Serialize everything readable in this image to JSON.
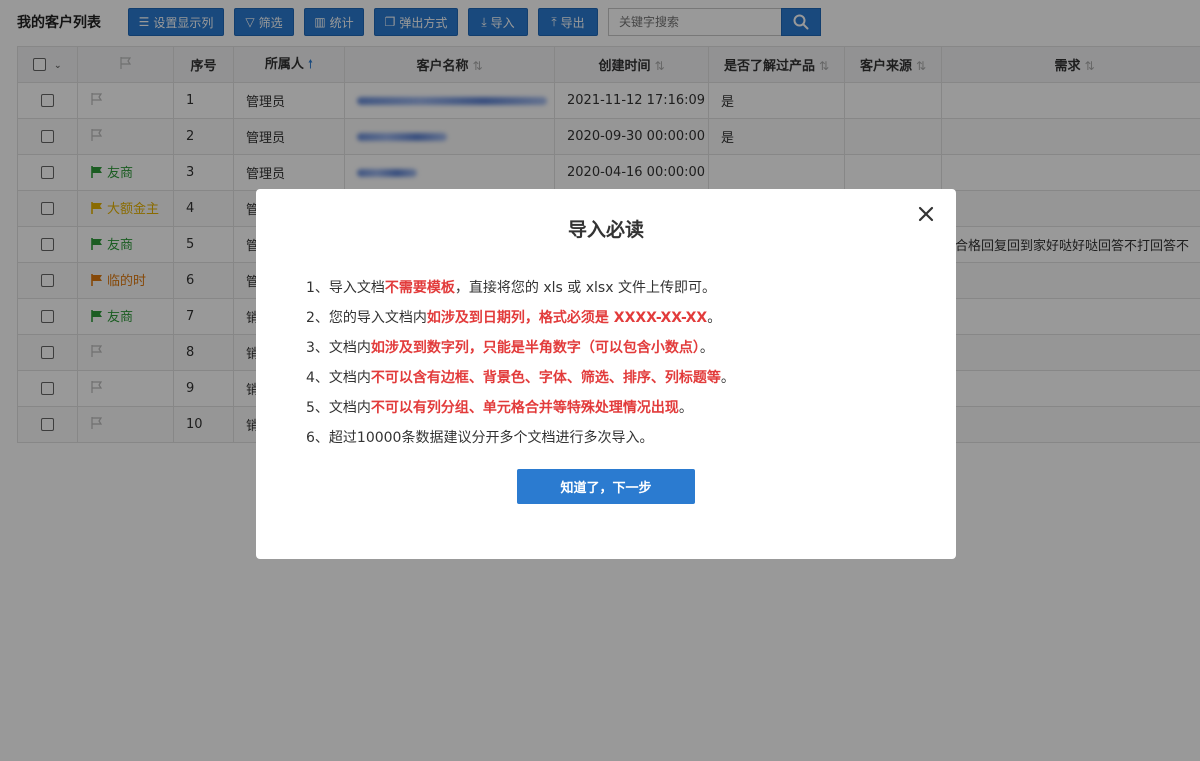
{
  "page": {
    "title": "我的客户列表"
  },
  "toolbar": {
    "buttons": [
      {
        "label": "设置显示列"
      },
      {
        "label": "筛选"
      },
      {
        "label": "统计"
      },
      {
        "label": "弹出方式"
      },
      {
        "label": "导入"
      },
      {
        "label": "导出"
      }
    ],
    "search_placeholder": "关键字搜索"
  },
  "table": {
    "headers": {
      "index": "序号",
      "owner": "所属人",
      "name": "客户名称",
      "created": "创建时间",
      "knows_product": "是否了解过产品",
      "source": "客户来源",
      "need": "需求"
    },
    "rows": [
      {
        "flag_label": "",
        "flag_color": "#bbbbbb",
        "index": "1",
        "owner": "管理员",
        "created": "2021-11-12 17:16:09",
        "knows_product": "是",
        "source": "",
        "need": ""
      },
      {
        "flag_label": "",
        "flag_color": "#bbbbbb",
        "index": "2",
        "owner": "管理员",
        "created": "2020-09-30 00:00:00",
        "knows_product": "是",
        "source": "",
        "need": ""
      },
      {
        "flag_label": "友商",
        "flag_color": "#2e9c3a",
        "index": "3",
        "owner": "管理员",
        "created": "2020-04-16 00:00:00",
        "knows_product": "",
        "source": "",
        "need": ""
      },
      {
        "flag_label": "大额金主",
        "flag_color": "#e6b200",
        "index": "4",
        "owner": "管",
        "created": "",
        "knows_product": "",
        "source": "",
        "need": ""
      },
      {
        "flag_label": "友商",
        "flag_color": "#2e9c3a",
        "index": "5",
        "owner": "管",
        "created": "",
        "knows_product": "",
        "source": "",
        "need": "不合格回复回到家好哒好哒回答不打回答不"
      },
      {
        "flag_label": "临的时",
        "flag_color": "#e07a10",
        "index": "6",
        "owner": "管",
        "created": "",
        "knows_product": "",
        "source": "",
        "need": ""
      },
      {
        "flag_label": "友商",
        "flag_color": "#2e9c3a",
        "index": "7",
        "owner": "销",
        "created": "",
        "knows_product": "",
        "source": "",
        "need": ""
      },
      {
        "flag_label": "",
        "flag_color": "#bbbbbb",
        "index": "8",
        "owner": "销",
        "created": "",
        "knows_product": "",
        "source": "",
        "need": ""
      },
      {
        "flag_label": "",
        "flag_color": "#bbbbbb",
        "index": "9",
        "owner": "销",
        "created": "",
        "knows_product": "",
        "source": "",
        "need": ""
      },
      {
        "flag_label": "",
        "flag_color": "#bbbbbb",
        "index": "10",
        "owner": "销",
        "created": "",
        "knows_product": "",
        "source": "",
        "need": ""
      }
    ]
  },
  "modal": {
    "title": "导入必读",
    "rules": [
      {
        "pre": "1、导入文档",
        "hl": "不需要模板",
        "post": "，直接将您的 xls 或 xlsx 文件上传即可。"
      },
      {
        "pre": "2、您的导入文档内",
        "hl": "如涉及到日期列，格式必须是 XXXX-XX-XX",
        "post": "。"
      },
      {
        "pre": "3、文档内",
        "hl": "如涉及到数字列，只能是半角数字（可以包含小数点）",
        "post": "。"
      },
      {
        "pre": "4、文档内",
        "hl": "不可以含有边框、背景色、字体、筛选、排序、列标题等",
        "post": "。"
      },
      {
        "pre": "5、文档内",
        "hl": "不可以有列分组、单元格合并等特殊处理情况出现",
        "post": "。"
      },
      {
        "pre": "6、超过10000条数据建议分开多个文档进行多次导入。",
        "hl": "",
        "post": ""
      }
    ],
    "next_label": "知道了，下一步"
  },
  "colors": {
    "primary": "#2b7bd0",
    "highlight": "#e23b3b",
    "overlay": "rgba(0,0,0,0.40)"
  }
}
